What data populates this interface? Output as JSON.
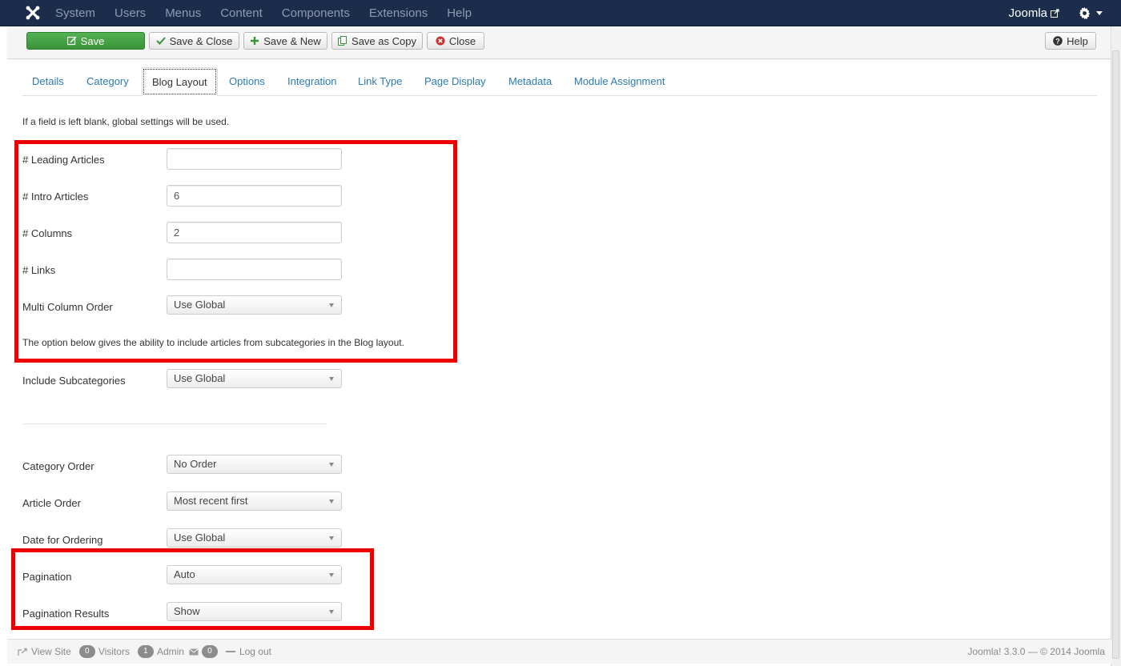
{
  "navbar": {
    "menu": [
      "System",
      "Users",
      "Menus",
      "Content",
      "Components",
      "Extensions",
      "Help"
    ],
    "site_label": "Joomla",
    "icons": [
      "joomla-logo-icon",
      "external-link-icon",
      "gear-icon",
      "caret-down-icon"
    ]
  },
  "toolbar": {
    "save": "Save",
    "save_close": "Save & Close",
    "save_new": "Save & New",
    "save_copy": "Save as Copy",
    "close": "Close",
    "help": "Help"
  },
  "tabs": [
    "Details",
    "Category",
    "Blog Layout",
    "Options",
    "Integration",
    "Link Type",
    "Page Display",
    "Metadata",
    "Module Assignment"
  ],
  "active_tab": "Blog Layout",
  "note": "If a field is left blank, global settings will be used.",
  "fields": {
    "leading_articles": {
      "label": "# Leading Articles",
      "value": ""
    },
    "intro_articles": {
      "label": "# Intro Articles",
      "value": "6"
    },
    "columns": {
      "label": "# Columns",
      "value": "2"
    },
    "links": {
      "label": "# Links",
      "value": ""
    },
    "multi_column_order": {
      "label": "Multi Column Order",
      "value": "Use Global"
    },
    "subcategory_note": "The option below gives the ability to include articles from subcategories in the Blog layout.",
    "include_subcategories": {
      "label": "Include Subcategories",
      "value": "Use Global"
    },
    "category_order": {
      "label": "Category Order",
      "value": "No Order"
    },
    "article_order": {
      "label": "Article Order",
      "value": "Most recent first"
    },
    "date_for_ordering": {
      "label": "Date for Ordering",
      "value": "Use Global"
    },
    "pagination": {
      "label": "Pagination",
      "value": "Auto"
    },
    "pagination_results": {
      "label": "Pagination Results",
      "value": "Show"
    }
  },
  "highlight_color": "#ee0000",
  "footer": {
    "view_site": "View Site",
    "visitors_count": "0",
    "visitors": "Visitors",
    "admin_count": "1",
    "admin": "Admin",
    "messages_count": "0",
    "logout": "Log out",
    "version": "Joomla! 3.3.0  —  © 2014 Joomla"
  }
}
